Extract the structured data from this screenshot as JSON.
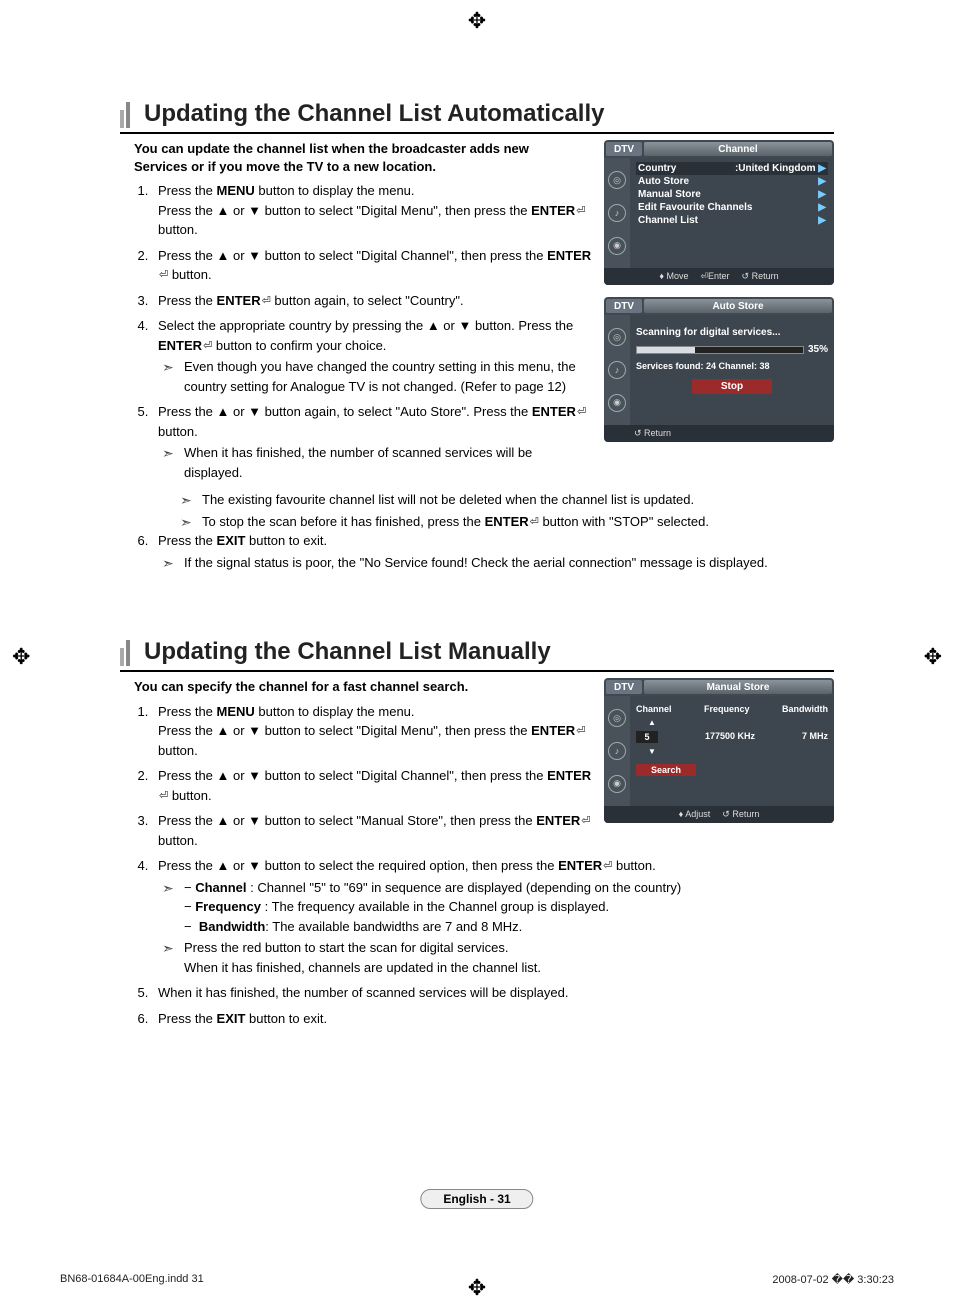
{
  "section1": {
    "title": "Updating the Channel List Automatically",
    "intro": "You can update the channel list when the broadcaster adds new Services or if you move the TV to a new location.",
    "steps": {
      "s1a": "Press the ",
      "s1b": "MENU",
      "s1c": " button to display the menu.",
      "s1sub": "Press the ▲ or ▼ button to select \"Digital Menu\", then press the ",
      "s1d": "ENTER",
      "s1e": " button.",
      "s2a": "Press the ▲ or ▼ button to select \"Digital Channel\", then press the ",
      "s2b": "ENTER",
      "s2c": " button.",
      "s3a": "Press the ",
      "s3b": "ENTER",
      "s3c": " button again, to select \"Country\".",
      "s4a": "Select the appropriate country by pressing the ▲ or ▼ button. Press the ",
      "s4b": "ENTER",
      "s4c": " button to confirm your choice.",
      "s4note": "Even though you have changed the country setting in this menu, the country setting for Analogue TV is not changed. (Refer to page 12)",
      "s5a": "Press the ▲ or ▼ button again, to select \"Auto Store\". Press the ",
      "s5b": "ENTER",
      "s5c": " button.",
      "s5note1": "When it has finished, the number of scanned services will be displayed.",
      "s5note2": "The existing favourite channel list will not be deleted when the channel list is updated.",
      "s5note3a": "To stop the scan before it has finished, press the ",
      "s5note3b": "ENTER",
      "s5note3c": " button with \"STOP\" selected.",
      "s6a": "Press the ",
      "s6b": "EXIT",
      "s6c": " button to exit.",
      "s6note": "If the signal status is poor, the \"No Service found! Check the aerial connection\" message is displayed."
    },
    "osd_channel": {
      "tag": "DTV",
      "title": "Channel",
      "rows": [
        {
          "label": "Country",
          "value": ":United Kingdom",
          "arrow": "▶"
        },
        {
          "label": "Auto Store",
          "value": "",
          "arrow": "▶"
        },
        {
          "label": "Manual Store",
          "value": "",
          "arrow": "▶"
        },
        {
          "label": "Edit Favourite Channels",
          "value": "",
          "arrow": "▶"
        },
        {
          "label": "Channel List",
          "value": "",
          "arrow": "▶"
        }
      ],
      "footer": {
        "move": "Move",
        "enter": "Enter",
        "return": "Return"
      }
    },
    "osd_autostore": {
      "tag": "DTV",
      "title": "Auto Store",
      "scanning": "Scanning for digital services...",
      "progress_pct": 35,
      "progress_label": "35%",
      "found": "Services found: 24     Channel: 38",
      "stop": "Stop",
      "footer_return": "Return"
    }
  },
  "section2": {
    "title": "Updating the Channel List Manually",
    "intro": "You can specify the channel for a fast channel search.",
    "steps": {
      "s1a": "Press the ",
      "s1b": "MENU",
      "s1c": " button to display the menu.",
      "s1sub": "Press the ▲ or ▼ button to select \"Digital Menu\", then press the ",
      "s1d": "ENTER",
      "s1e": " button.",
      "s2a": "Press the ▲ or ▼ button to select \"Digital Channel\", then press the ",
      "s2b": "ENTER",
      "s2c": " button.",
      "s3a": "Press the ▲ or ▼ button to select \"Manual Store\", then press the ",
      "s3b": "ENTER",
      "s3c": " button.",
      "s4a": "Press the ▲ or ▼ button to select the required option, then press the ",
      "s4b": "ENTER",
      "s4c": " button.",
      "s4note1_pre": "− ",
      "s4note1_ch": "Channel",
      "s4note1_txt": " : Channel \"5\" to \"69\" in sequence are displayed (depending on the country)",
      "s4note1_fr": "Frequency",
      "s4note1_fr_txt": " : The frequency available in the Channel group is displayed.",
      "s4note1_bw": "Bandwidth",
      "s4note1_bw_txt": ": The available bandwidths are 7 and 8 MHz.",
      "s4note2a": "Press the red button to start the scan for digital services.",
      "s4note2b": "When it has finished, channels are updated in the channel list.",
      "s5": "When it has finished, the number of scanned services will be displayed.",
      "s6a": "Press the ",
      "s6b": "EXIT",
      "s6c": " button to exit."
    },
    "osd_manualstore": {
      "tag": "DTV",
      "title": "Manual Store",
      "col_channel": "Channel",
      "col_frequency": "Frequency",
      "col_bandwidth": "Bandwidth",
      "val_channel": "5",
      "val_freq": "177500",
      "val_freq_unit": "KHz",
      "val_bw": "7",
      "val_bw_unit": "MHz",
      "search": "Search",
      "footer_adjust": "Adjust",
      "footer_return": "Return"
    }
  },
  "page_number": "English - 31",
  "footer_left": "BN68-01684A-00Eng.indd   31",
  "footer_right": "2008-07-02   �� 3:30:23"
}
